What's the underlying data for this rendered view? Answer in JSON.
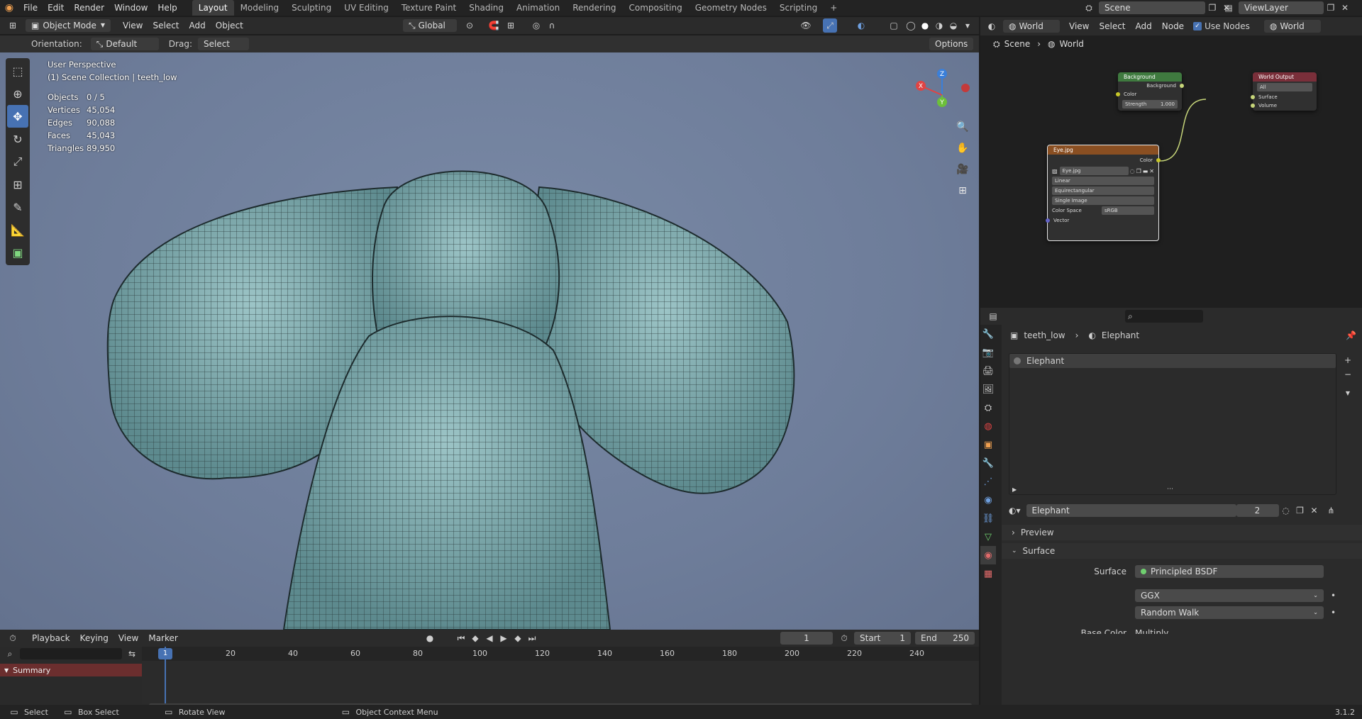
{
  "topbar": {
    "menus": [
      "File",
      "Edit",
      "Render",
      "Window",
      "Help"
    ],
    "workspaces": [
      "Layout",
      "Modeling",
      "Sculpting",
      "UV Editing",
      "Texture Paint",
      "Shading",
      "Animation",
      "Rendering",
      "Compositing",
      "Geometry Nodes",
      "Scripting"
    ],
    "active_workspace": "Layout",
    "add_tab": "+",
    "scene_label": "Scene",
    "viewlayer_label": "ViewLayer"
  },
  "viewport_header": {
    "mode": "Object Mode",
    "menus": [
      "View",
      "Select",
      "Add",
      "Object"
    ],
    "transform_orientation": "Global",
    "orientation_label": "Orientation:",
    "orientation_value": "Default",
    "drag_label": "Drag:",
    "drag_value": "Select Box",
    "options": "Options"
  },
  "viewport": {
    "perspective": "User Perspective",
    "collection": "(1) Scene Collection | teeth_low",
    "stats": [
      {
        "label": "Objects",
        "value": "0 / 5"
      },
      {
        "label": "Vertices",
        "value": "45,054"
      },
      {
        "label": "Edges",
        "value": "90,088"
      },
      {
        "label": "Faces",
        "value": "45,043"
      },
      {
        "label": "Triangles",
        "value": "89,950"
      }
    ],
    "gizmo": {
      "x": "X",
      "y": "Y",
      "z": "Z"
    }
  },
  "node_editor": {
    "header_world_type": "World",
    "menus": [
      "View",
      "Select",
      "Add",
      "Node"
    ],
    "use_nodes_label": "Use Nodes",
    "world_name": "World",
    "breadcrumb": [
      "Scene",
      "World"
    ],
    "background_node": {
      "title": "Background",
      "output": "Background",
      "color_label": "Color",
      "strength_label": "Strength",
      "strength_value": "1.000"
    },
    "world_output_node": {
      "title": "World Output",
      "target": "All",
      "surface": "Surface",
      "volume": "Volume"
    },
    "image_node": {
      "title": "Eye.jpg",
      "output": "Color",
      "image_name": "Eye.jpg",
      "interpolation": "Linear",
      "projection": "Equirectangular",
      "source": "Single Image",
      "colorspace_label": "Color Space",
      "colorspace_value": "sRGB",
      "vector": "Vector"
    }
  },
  "properties": {
    "breadcrumb_object": "teeth_low",
    "breadcrumb_material": "Elephant",
    "slot_name": "Elephant",
    "material_name": "Elephant",
    "user_count": "2",
    "panels": {
      "preview": "Preview",
      "surface": "Surface"
    },
    "surface_label": "Surface",
    "surface_shader": "Principled BSDF",
    "distribution": "GGX",
    "subsurface_method": "Random Walk",
    "cut_row_label": "Base Color",
    "cut_row_value": "Multiply"
  },
  "timeline": {
    "menus": [
      "Playback",
      "Keying",
      "View",
      "Marker"
    ],
    "current_frame": "1",
    "start_label": "Start",
    "start_value": "1",
    "end_label": "End",
    "end_value": "250",
    "ruler": [
      "1",
      "20",
      "40",
      "60",
      "80",
      "100",
      "120",
      "140",
      "160",
      "180",
      "200",
      "220",
      "240"
    ],
    "summary": "Summary"
  },
  "statusbar": {
    "select": "Select",
    "box_select": "Box Select",
    "rotate_view": "Rotate View",
    "context_menu": "Object Context Menu",
    "version": "3.1.2"
  },
  "colors": {
    "accent": "#4772b3",
    "viewport_bg": "#6e7d9a",
    "mesh": "#7fa8ad",
    "active_frame": "#4772b3",
    "node_link": "#c7d67a"
  }
}
